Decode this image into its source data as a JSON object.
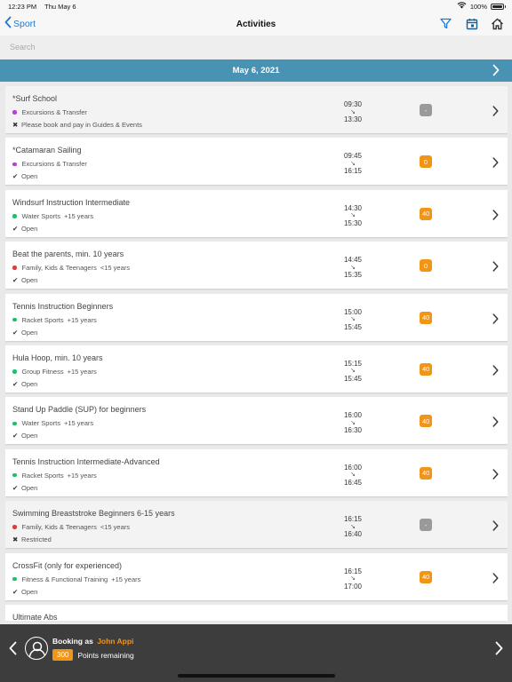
{
  "status_bar": {
    "time": "12:23 PM",
    "date": "Thu May 6",
    "battery": "100%"
  },
  "nav": {
    "back_label": "Sport",
    "title": "Activities"
  },
  "search": {
    "placeholder": "Search"
  },
  "date_bar": {
    "date": "May 6, 2021"
  },
  "colors": {
    "accent_blue": "#1f78d1",
    "date_bar": "#4892b4",
    "orange": "#f29517",
    "purple": "#b23fd6",
    "green": "#1fbf66",
    "red": "#e03a3a"
  },
  "activities": [
    {
      "name": "*Surf School",
      "category": "Excursions & Transfer",
      "age": "",
      "dot_color": "#b23fd6",
      "status_icon": "x-icon",
      "status_mark": "✖",
      "status": "Please book and pay in Guides & Events",
      "start": "09:30",
      "end": "13:30",
      "badge": "-",
      "badge_type": "gray",
      "restricted": true
    },
    {
      "name": "*Catamaran Sailing",
      "category": "Excursions & Transfer",
      "age": "",
      "dot_color": "#b23fd6",
      "status_icon": "check-icon",
      "status_mark": "✔",
      "status": "Open",
      "start": "09:45",
      "end": "16:15",
      "badge": "0",
      "badge_type": "orange",
      "restricted": false
    },
    {
      "name": "Windsurf Instruction Intermediate",
      "category": "Water Sports",
      "age": "+15 years",
      "dot_color": "#1fbf66",
      "status_icon": "check-icon",
      "status_mark": "✔",
      "status": "Open",
      "start": "14:30",
      "end": "15:30",
      "badge": "40",
      "badge_type": "orange",
      "restricted": false
    },
    {
      "name": "Beat the parents, min. 10 years",
      "category": "Family, Kids & Teenagers",
      "age": "<15 years",
      "dot_color": "#e03a3a",
      "status_icon": "check-icon",
      "status_mark": "✔",
      "status": "Open",
      "start": "14:45",
      "end": "15:35",
      "badge": "0",
      "badge_type": "orange",
      "restricted": false
    },
    {
      "name": "Tennis Instruction Beginners",
      "category": "Racket Sports",
      "age": "+15 years",
      "dot_color": "#1fbf66",
      "status_icon": "check-icon",
      "status_mark": "✔",
      "status": "Open",
      "start": "15:00",
      "end": "15:45",
      "badge": "40",
      "badge_type": "orange",
      "restricted": false
    },
    {
      "name": "Hula Hoop, min. 10 years",
      "category": "Group Fitness",
      "age": "+15 years",
      "dot_color": "#1fbf66",
      "status_icon": "check-icon",
      "status_mark": "✔",
      "status": "Open",
      "start": "15:15",
      "end": "15:45",
      "badge": "40",
      "badge_type": "orange",
      "restricted": false
    },
    {
      "name": "Stand Up Paddle (SUP) for beginners",
      "category": "Water Sports",
      "age": "+15 years",
      "dot_color": "#1fbf66",
      "status_icon": "check-icon",
      "status_mark": "✔",
      "status": "Open",
      "start": "16:00",
      "end": "16:30",
      "badge": "40",
      "badge_type": "orange",
      "restricted": false
    },
    {
      "name": "Tennis Instruction Intermediate-Advanced",
      "category": "Racket Sports",
      "age": "+15 years",
      "dot_color": "#1fbf66",
      "status_icon": "check-icon",
      "status_mark": "✔",
      "status": "Open",
      "start": "16:00",
      "end": "16:45",
      "badge": "40",
      "badge_type": "orange",
      "restricted": false
    },
    {
      "name": "Swimming Breaststroke Beginners 6-15 years",
      "category": "Family, Kids & Teenagers",
      "age": "<15 years",
      "dot_color": "#e03a3a",
      "status_icon": "x-icon",
      "status_mark": "✖",
      "status": "Restricted",
      "start": "16:15",
      "end": "16:40",
      "badge": "-",
      "badge_type": "gray",
      "restricted": true
    },
    {
      "name": "CrossFit (only for experienced)",
      "category": "Fitness & Functional Training",
      "age": "+15 years",
      "dot_color": "#1fbf66",
      "status_icon": "check-icon",
      "status_mark": "✔",
      "status": "Open",
      "start": "16:15",
      "end": "17:00",
      "badge": "40",
      "badge_type": "orange",
      "restricted": false
    }
  ],
  "partial_activity": {
    "name": "Ultimate Abs"
  },
  "footer": {
    "booking_as": "Booking as",
    "user": "John Appi",
    "points": "300",
    "points_label": "Points remaining"
  }
}
